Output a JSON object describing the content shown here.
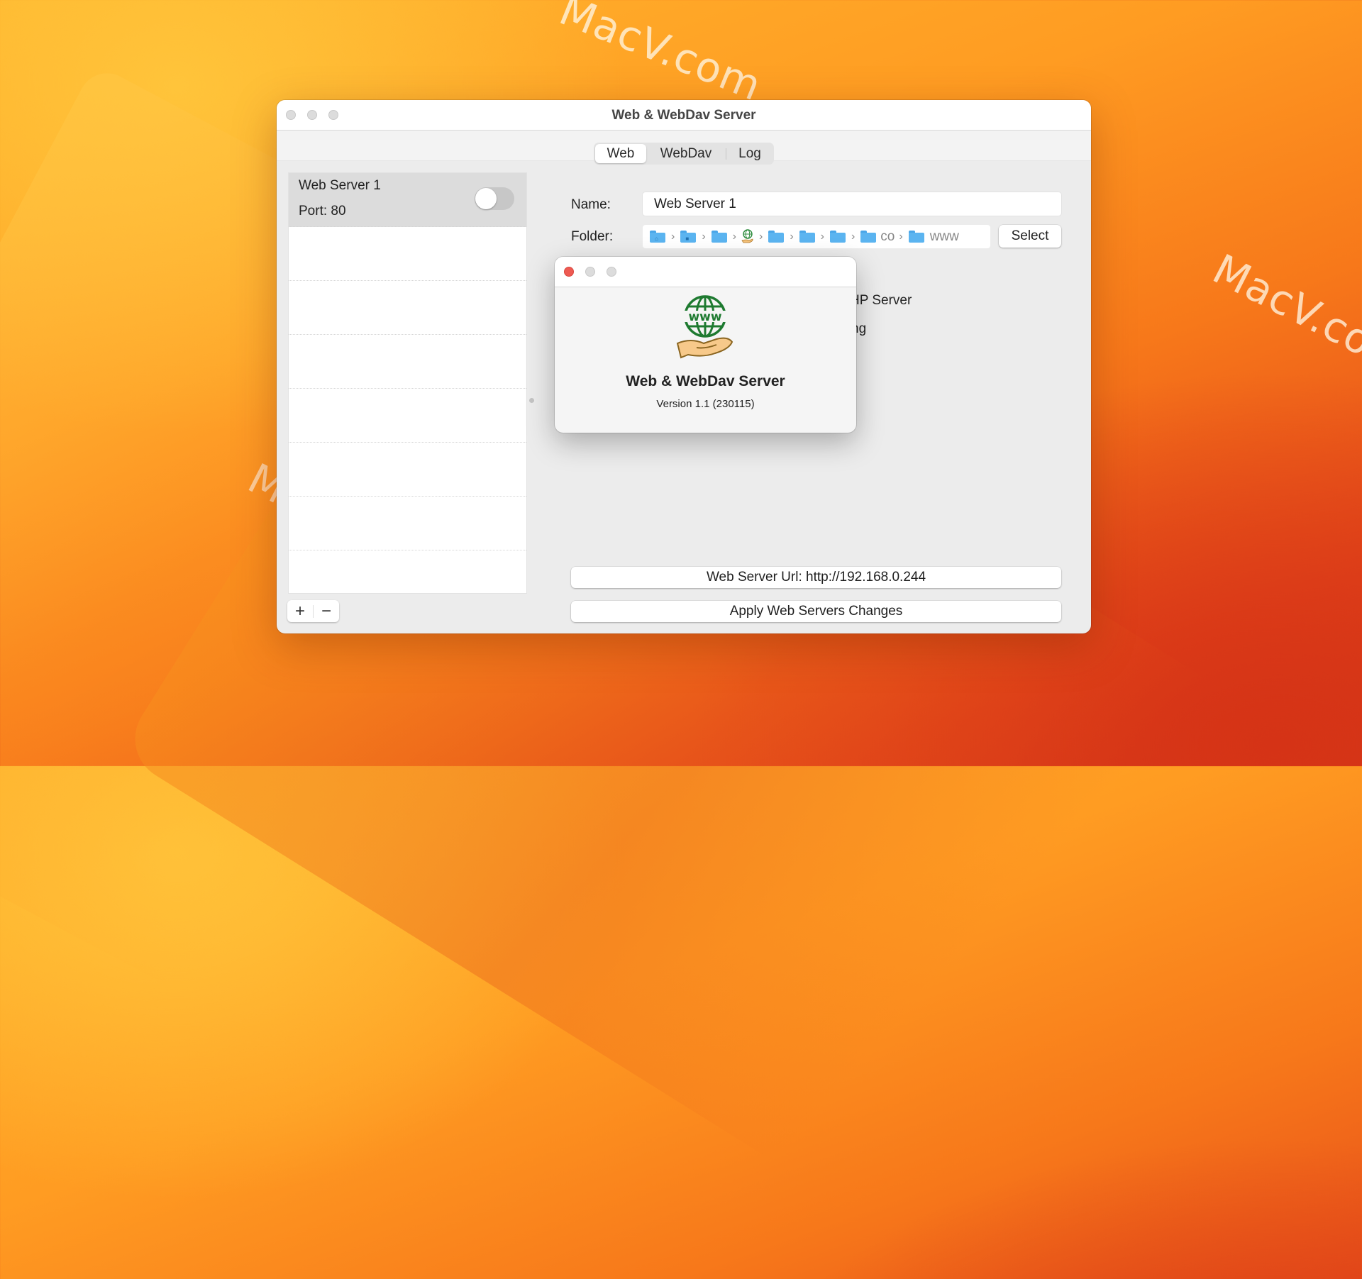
{
  "desktop": {
    "watermark": "MacV.com"
  },
  "window": {
    "title": "Web & WebDav Server",
    "tabs": [
      {
        "label": "Web",
        "active": true
      },
      {
        "label": "WebDav",
        "active": false
      },
      {
        "label": "Log",
        "active": false
      }
    ],
    "server_list": {
      "items": [
        {
          "title": "Web Server 1",
          "port_label": "Port: 80",
          "enabled": false
        }
      ],
      "empty_rows": 6,
      "add_label": "+",
      "remove_label": "−"
    },
    "form": {
      "name_label": "Name:",
      "name_value": "Web Server 1",
      "folder_label": "Folder:",
      "folder_path": [
        {
          "icon": "home-folder-icon",
          "text": ""
        },
        {
          "icon": "user-folder-icon",
          "text": ""
        },
        {
          "icon": "folder-icon",
          "text": ""
        },
        {
          "icon": "app-icon",
          "text": ""
        },
        {
          "icon": "folder-icon",
          "text": ""
        },
        {
          "icon": "folder-icon",
          "text": ""
        },
        {
          "icon": "folder-icon",
          "text": ""
        },
        {
          "icon": "folder-icon",
          "text": "co"
        },
        {
          "icon": "folder-icon",
          "text": "www"
        }
      ],
      "select_label": "Select",
      "partial_option_1": "HP Server",
      "partial_option_2": "ng"
    },
    "url_label": "Web Server Url: http://192.168.0.244",
    "apply_label": "Apply Web Servers Changes"
  },
  "about_dialog": {
    "app_name": "Web & WebDav Server",
    "version": "Version 1.1 (230115)",
    "close_color": "#ee5a52"
  }
}
